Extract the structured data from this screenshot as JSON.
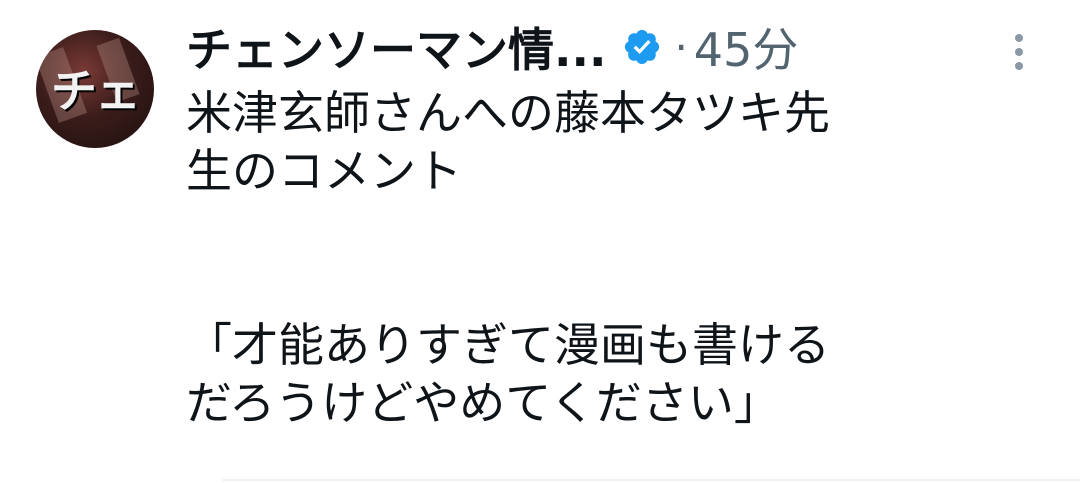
{
  "account": {
    "display_name": "チェンソーマン情...",
    "avatar_text": "チェ",
    "verified": true,
    "separator": "·",
    "timestamp": "45分"
  },
  "tweet": {
    "line1": "米津玄師さんへの藤本タツキ先",
    "line2": "生のコメント",
    "line3": "「才能ありすぎて漫画も書ける",
    "line4": "だろうけどやめてください」"
  },
  "icons": {
    "verified": "verified-badge-icon",
    "more": "more-vertical-icon"
  },
  "colors": {
    "verified_blue": "#1d9bf0",
    "secondary_text": "#536471",
    "primary_text": "#0f1419"
  }
}
